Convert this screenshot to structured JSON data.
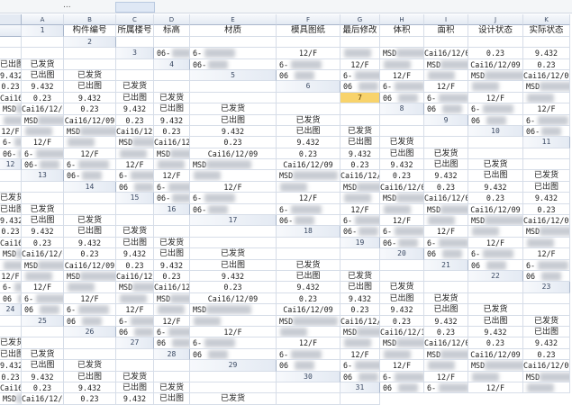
{
  "formula_bar": {
    "name_box_fragment": "..."
  },
  "columns": [
    "A",
    "B",
    "C",
    "D",
    "E",
    "F",
    "G",
    "H",
    "I",
    "J",
    "K"
  ],
  "headers": [
    "构件编号",
    "所属楼号",
    "标高",
    "材质",
    "模具图纸",
    "最后修改",
    "体积",
    "面积",
    "设计状态",
    "实际状态",
    ""
  ],
  "selected_row": 7,
  "rows": [
    {
      "n": "2",
      "cells": [
        "",
        "",
        "",
        "",
        "",
        "",
        "",
        "",
        "",
        ""
      ]
    },
    {
      "n": "3",
      "cells": [
        "06-",
        "6-",
        "12/F",
        "",
        "MSD",
        "Cai16/12/09",
        "0.23",
        "9.432",
        "已出图",
        "已发货"
      ]
    },
    {
      "n": "4",
      "cells": [
        "06-",
        "6-",
        "12/F",
        "",
        "MSD",
        "Cai16/12/09",
        "0.23",
        "9.432",
        "已出图",
        "已发货"
      ]
    },
    {
      "n": "5",
      "cells": [
        "06",
        "6-",
        "12/F",
        "",
        "MSD",
        "Cai16/12/09",
        "0.23",
        "9.432",
        "已出图",
        "已发货"
      ]
    },
    {
      "n": "6",
      "cells": [
        "06",
        "6-",
        "12/F",
        "",
        "MSD",
        "Cai16/12/09",
        "0.23",
        "9.432",
        "已出图",
        "已发货"
      ]
    },
    {
      "n": "7",
      "cells": [
        "06",
        "6-",
        "12/F",
        "",
        "MSD",
        "Cai16/12/09",
        "0.23",
        "9.432",
        "已出图",
        "已发货"
      ]
    },
    {
      "n": "8",
      "cells": [
        "06",
        "6-",
        "12/F",
        "",
        "MSD",
        "Cai16/12/09",
        "0.23",
        "9.432",
        "已出图",
        "已发货"
      ]
    },
    {
      "n": "9",
      "cells": [
        "06",
        "6-",
        "12/F",
        "",
        "MSD",
        "Cai16/12/15",
        "0.23",
        "9.432",
        "已出图",
        "已发货"
      ]
    },
    {
      "n": "10",
      "cells": [
        "06-",
        "6-",
        "12/F",
        "",
        "MSD",
        "Cai16/12/15",
        "0.23",
        "9.432",
        "已出图",
        "已发货"
      ]
    },
    {
      "n": "11",
      "cells": [
        "06-",
        "6-",
        "12/F",
        "",
        "MSD",
        "Cai16/12/09",
        "0.23",
        "9.432",
        "已出图",
        "已发货"
      ]
    },
    {
      "n": "12",
      "cells": [
        "06-",
        "6-",
        "12/F",
        "",
        "MSD",
        "Cai16/12/09",
        "0.23",
        "9.432",
        "已出图",
        "已发货"
      ]
    },
    {
      "n": "13",
      "cells": [
        "06-",
        "6-",
        "12/F",
        "",
        "MSD",
        "Cai16/12/09",
        "0.23",
        "9.432",
        "已出图",
        "已发货"
      ]
    },
    {
      "n": "14",
      "cells": [
        "06",
        "6-",
        "12/F",
        "",
        "MSD",
        "Cai16/12/09",
        "0.23",
        "9.432",
        "已出图",
        "已发货"
      ]
    },
    {
      "n": "15",
      "cells": [
        "06-",
        "6-",
        "12/F",
        "",
        "MSD",
        "Cai16/12/09",
        "0.23",
        "9.432",
        "已出图",
        "已发货"
      ]
    },
    {
      "n": "16",
      "cells": [
        "06-",
        "6-",
        "12/F",
        "",
        "MSD",
        "Cai16/12/09",
        "0.23",
        "9.432",
        "已出图",
        "已发货"
      ]
    },
    {
      "n": "17",
      "cells": [
        "06-",
        "6-",
        "12/F",
        "",
        "MSD",
        "Cai16/12/09",
        "0.23",
        "9.432",
        "已出图",
        "已发货"
      ]
    },
    {
      "n": "18",
      "cells": [
        "06-",
        "6-",
        "12/F",
        "",
        "MSD",
        "Cai16/12/09",
        "0.23",
        "9.432",
        "已出图",
        "已发货"
      ]
    },
    {
      "n": "19",
      "cells": [
        "06-",
        "6-",
        "12/F",
        "",
        "MSD",
        "Cai16/12/09",
        "0.23",
        "9.432",
        "已出图",
        "已发货"
      ]
    },
    {
      "n": "20",
      "cells": [
        "06",
        "6-",
        "12/F",
        "",
        "MSD",
        "Cai16/12/09",
        "0.23",
        "9.432",
        "已出图",
        "已发货"
      ]
    },
    {
      "n": "21",
      "cells": [
        "06",
        "6-",
        "12/F",
        "",
        "MSD",
        "Cai16/12/09",
        "0.23",
        "9.432",
        "已出图",
        "已发货"
      ]
    },
    {
      "n": "22",
      "cells": [
        "06",
        "6-",
        "12/F",
        "",
        "MSD",
        "Cai16/12/09",
        "0.23",
        "9.432",
        "已出图",
        "已发货"
      ]
    },
    {
      "n": "23",
      "cells": [
        "06",
        "6-",
        "12/F",
        "",
        "MSD",
        "Cai16/12/09",
        "0.23",
        "9.432",
        "已出图",
        "已发货"
      ]
    },
    {
      "n": "24",
      "cells": [
        "06",
        "6-",
        "12/F",
        "",
        "MSD",
        "Cai16/12/09",
        "0.23",
        "9.432",
        "已出图",
        "已发货"
      ]
    },
    {
      "n": "25",
      "cells": [
        "06",
        "6-",
        "12/F",
        "",
        "MSD",
        "Cai16/12/15",
        "0.23",
        "9.432",
        "已出图",
        "已发货"
      ]
    },
    {
      "n": "26",
      "cells": [
        "06",
        "6-",
        "12/F",
        "",
        "MSD",
        "Cai16/12/15",
        "0.23",
        "9.432",
        "已出图",
        "已发货"
      ]
    },
    {
      "n": "27",
      "cells": [
        "06",
        "6-",
        "12/F",
        "",
        "MSD",
        "Cai16/12/09",
        "0.23",
        "9.432",
        "已出图",
        "已发货"
      ]
    },
    {
      "n": "28",
      "cells": [
        "06",
        "6-",
        "12/F",
        "",
        "MSD",
        "Cai16/12/09",
        "0.23",
        "9.432",
        "已出图",
        "已发货"
      ]
    },
    {
      "n": "29",
      "cells": [
        "06",
        "6-",
        "12/F",
        "",
        "MSD",
        "Cai16/12/09",
        "0.23",
        "9.432",
        "已出图",
        "已发货"
      ]
    },
    {
      "n": "30",
      "cells": [
        "06",
        "6-",
        "12/F",
        "",
        "MSD",
        "Cai16/12/09",
        "0.23",
        "9.432",
        "已出图",
        "已发货"
      ]
    },
    {
      "n": "31",
      "cells": [
        "06",
        "6-",
        "12/F",
        "",
        "MSD",
        "Cai16/12/09",
        "0.23",
        "9.432",
        "已出图",
        "已发货"
      ]
    }
  ]
}
